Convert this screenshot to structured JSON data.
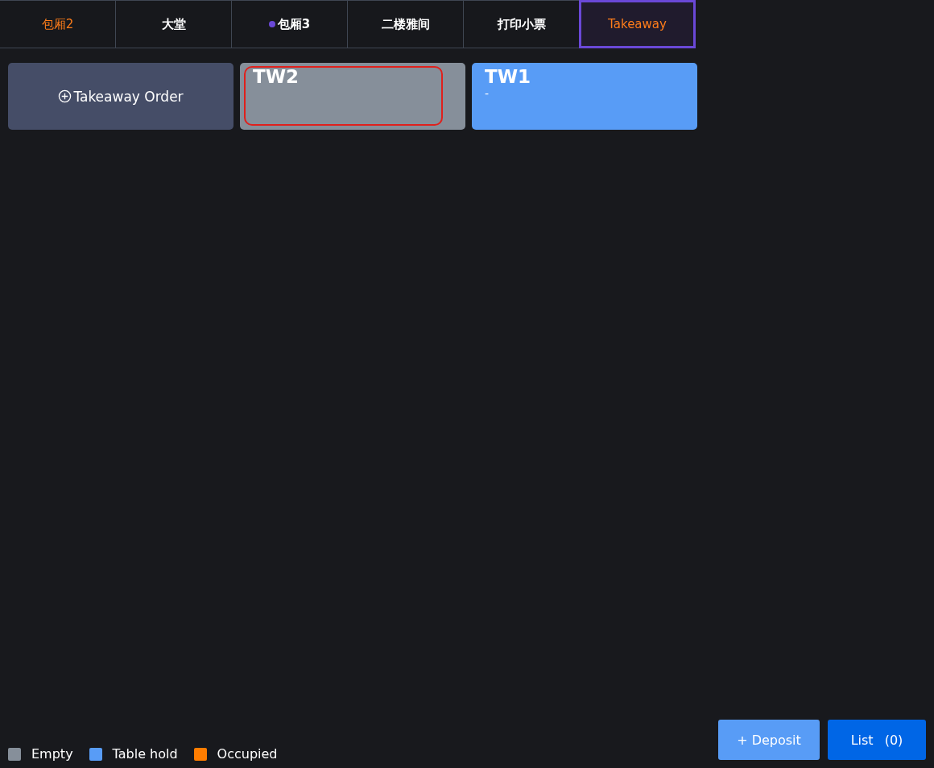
{
  "tabs": [
    {
      "label": "包厢2",
      "selected": false,
      "highlighted": true,
      "has_dot": false
    },
    {
      "label": "大堂",
      "selected": false,
      "highlighted": false,
      "has_dot": false
    },
    {
      "label": "包厢3",
      "selected": false,
      "highlighted": false,
      "has_dot": true
    },
    {
      "label": "二楼雅间",
      "selected": false,
      "highlighted": false,
      "has_dot": false
    },
    {
      "label": "打印小票",
      "selected": false,
      "highlighted": false,
      "has_dot": false
    },
    {
      "label": "Takeaway",
      "selected": true,
      "highlighted": true,
      "has_dot": false
    }
  ],
  "cards": [
    {
      "kind": "add",
      "label": "Takeaway Order"
    },
    {
      "kind": "table",
      "name": "TW2",
      "color": "#868f9a",
      "focused": true
    },
    {
      "kind": "table",
      "name": "TW1",
      "color": "#589cf6",
      "focused": false,
      "subtitle": "-"
    }
  ],
  "legend": [
    {
      "label": "Empty",
      "color": "#868f9a"
    },
    {
      "label": "Table hold",
      "color": "#589cf6"
    },
    {
      "label": "Occupied",
      "color": "#ff7d00"
    }
  ],
  "buttons": [
    {
      "kind": "deposit",
      "label": "+ Deposit"
    },
    {
      "kind": "list",
      "label": "List",
      "count": "(0)"
    }
  ]
}
